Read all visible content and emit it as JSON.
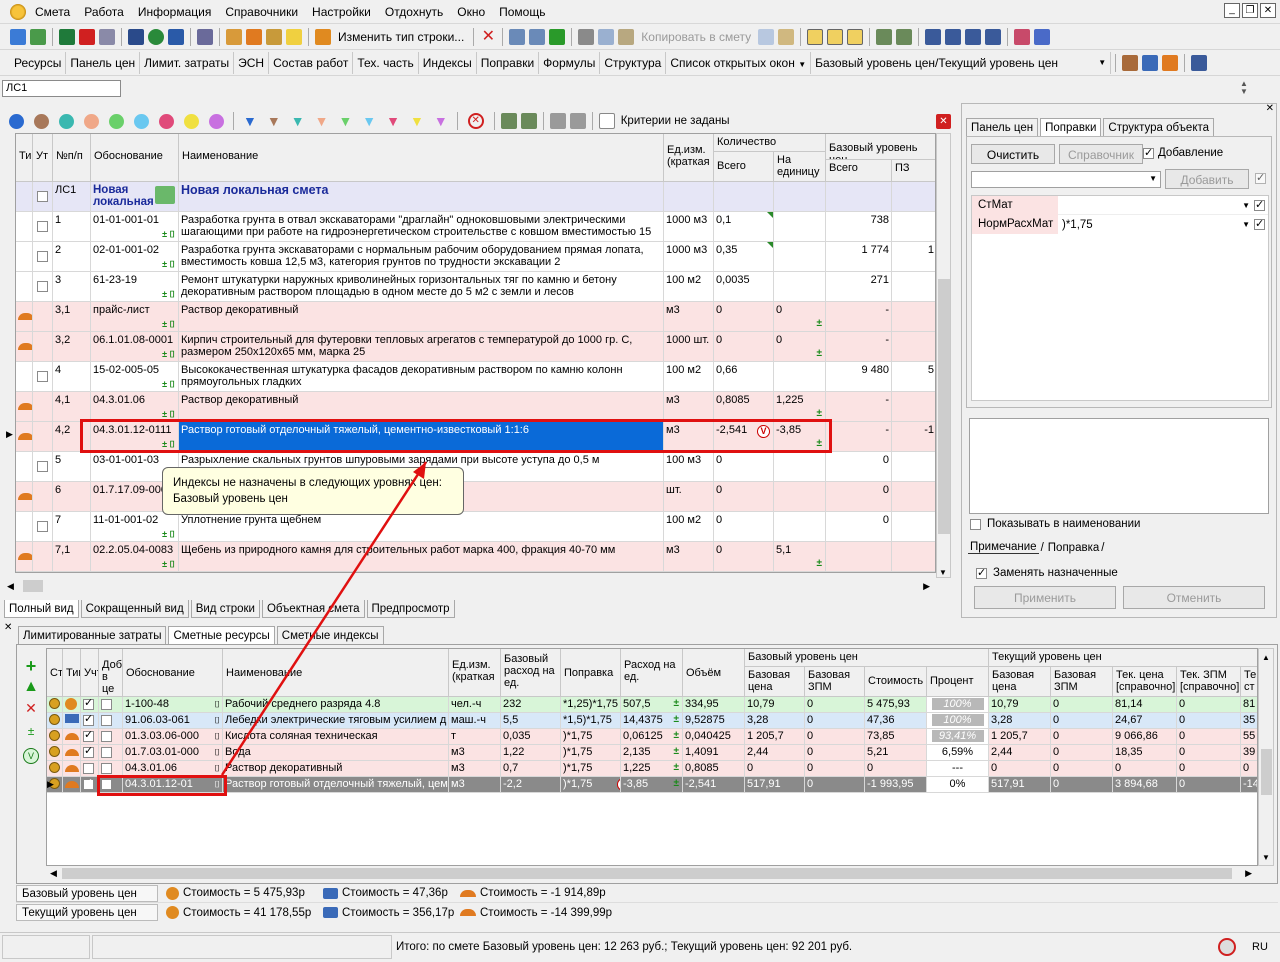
{
  "menu": [
    "Смета",
    "Работа",
    "Информация",
    "Справочники",
    "Настройки",
    "Отдохнуть",
    "Окно",
    "Помощь"
  ],
  "toolbar": {
    "change_row_type": "Изменить тип строки...",
    "copy_to_estimate": "Копировать в смету"
  },
  "tabs_top": [
    "Ресурсы",
    "Панель цен",
    "Лимит. затраты",
    "ЭСН",
    "Состав работ",
    "Тех. часть",
    "Индексы",
    "Поправки",
    "Формулы",
    "Структура",
    "Список открытых окон",
    "Базовый уровень цен/Текущий уровень цен"
  ],
  "path_field": "ЛС1",
  "filter_status": "Критерии не заданы",
  "grid_headers": {
    "ti": "Ти",
    "ut": "Ут",
    "num": "№п/п",
    "basis": "Обоснование",
    "name": "Наименование",
    "unit": "Ед.изм. (краткая",
    "qty": "Количество",
    "qty_total": "Всего",
    "qty_per": "На единицу",
    "base_level": "Базовый уровень цен",
    "base_total": "Всего",
    "pz": "ПЗ"
  },
  "grid_rows": [
    {
      "num": "ЛС1",
      "basis": "Новая локальная",
      "name": "Новая локальная смета",
      "unit": "",
      "total": "",
      "per": "",
      "sum": "",
      "pz": "",
      "style": "header"
    },
    {
      "num": "1",
      "basis": "01-01-001-01",
      "name": "Разработка грунта в отвал экскаваторами \"драглайн\" одноковшовыми электрическими шагающими при работе на гидроэнергетическом строительстве с ковшом вместимостью 15",
      "unit": "1000 м3",
      "total": "0,1",
      "per": "",
      "sum": "738",
      "pz": "",
      "style": "white"
    },
    {
      "num": "2",
      "basis": "02-01-001-02",
      "name": "Разработка грунта экскаваторами с нормальным рабочим оборудованием прямая лопата, вместимость ковша 12,5 м3, категория грунтов по трудности экскавации 2",
      "unit": "1000 м3",
      "total": "0,35",
      "per": "",
      "sum": "1 774",
      "pz": "1",
      "style": "white"
    },
    {
      "num": "3",
      "basis": "61-23-19",
      "name": "Ремонт штукатурки наружных криволинейных горизонтальных тяг по камню и бетону декоративным раствором площадью в одном месте до 5 м2 с земли и лесов",
      "unit": "100 м2",
      "total": "0,0035",
      "per": "",
      "sum": "271",
      "pz": "",
      "style": "white"
    },
    {
      "num": "3,1",
      "basis": "прайс-лист",
      "name": "Раствор декоративный",
      "unit": "м3",
      "total": "0",
      "per": "0",
      "sum": "-",
      "pz": "",
      "style": "pink"
    },
    {
      "num": "3,2",
      "basis": "06.1.01.08-0001",
      "name": "Кирпич строительный для футеровки тепловых агрегатов с температурой до 1000 гр. С, размером 250х120х65 мм, марка 25",
      "unit": "1000 шт.",
      "total": "0",
      "per": "0",
      "sum": "-",
      "pz": "",
      "style": "pink"
    },
    {
      "num": "4",
      "basis": "15-02-005-05",
      "name": "Высококачественная штукатурка фасадов декоративным раствором по камню колонн прямоугольных гладких",
      "unit": "100 м2",
      "total": "0,66",
      "per": "",
      "sum": "9 480",
      "pz": "5",
      "style": "white"
    },
    {
      "num": "4,1",
      "basis": "04.3.01.06",
      "name": "Раствор декоративный",
      "unit": "м3",
      "total": "0,8085",
      "per": "1,225",
      "sum": "-",
      "pz": "",
      "style": "pink"
    },
    {
      "num": "4,2",
      "basis": "04.3.01.12-0111",
      "name": "Раствор готовый отделочный тяжелый, цементно-известковый 1:1:6",
      "unit": "м3",
      "total": "-2,541",
      "per": "-3,85",
      "sum": "-",
      "pz": "-1",
      "style": "pink"
    },
    {
      "num": "5",
      "basis": "03-01-001-03",
      "name": "Разрыхление скальных грунтов шпуровыми зарядами при высоте уступа до 0,5 м",
      "unit": "100 м3",
      "total": "0",
      "per": "",
      "sum": "0",
      "pz": "",
      "style": "white"
    },
    {
      "num": "6",
      "basis": "01.7.17.09-000",
      "name": "",
      "unit": "шт.",
      "total": "0",
      "per": "",
      "sum": "0",
      "pz": "",
      "style": "pink"
    },
    {
      "num": "7",
      "basis": "11-01-001-02",
      "name": "Уплотнение грунта щебнем",
      "unit": "100 м2",
      "total": "0",
      "per": "",
      "sum": "0",
      "pz": "",
      "style": "white"
    },
    {
      "num": "7,1",
      "basis": "02.2.05.04-0083",
      "name": "Щебень из природного камня для строительных работ марка 400, фракция 40-70 мм",
      "unit": "м3",
      "total": "0",
      "per": "5,1",
      "sum": "",
      "pz": "",
      "style": "pink"
    }
  ],
  "tooltip": {
    "line1": "Индексы не назначены в следующих уровнях цен:",
    "line2": "Базовый уровень цен"
  },
  "view_tabs": [
    "Полный вид",
    "Сокращенный вид",
    "Вид строки",
    "Объектная смета",
    "Предпросмотр"
  ],
  "right_panel": {
    "tabs": [
      "Панель цен",
      "Поправки",
      "Структура объекта"
    ],
    "clear": "Очистить",
    "directory": "Справочник",
    "adding": "Добавление",
    "add": "Добавить",
    "items": [
      {
        "name": "СтМат",
        "value": ""
      },
      {
        "name": "НормРасхМат",
        "value": ")*1,75"
      }
    ],
    "show_in_name": "Показывать в наименовании",
    "note_tab": "Примечание",
    "correction_tab": "Поправка",
    "replace_assigned": "Заменять назначенные",
    "apply": "Применить",
    "cancel": "Отменить"
  },
  "bottom_tabs": [
    "Лимитированные затраты",
    "Сметные ресурсы",
    "Сметные индексы"
  ],
  "res_headers": {
    "st": "Ста",
    "tip": "Тип",
    "uch": "Учт",
    "dob": "Доб в це",
    "basis": "Обоснование",
    "name": "Наименование",
    "unit": "Ед.изм. (краткая",
    "base_rate": "Базовый расход на ед.",
    "corr": "Поправка",
    "rate": "Расход на ед.",
    "vol": "Объём",
    "base_group": "Базовый уровень цен",
    "base_price": "Базовая цена",
    "base_zpm": "Базовая ЗПМ",
    "cost": "Стоимость",
    "pct": "Процент",
    "cur_group": "Текущий уровень цен",
    "cur_price": "Базовая цена",
    "cur_zpm": "Базовая ЗПМ",
    "tek_price": "Тек. цена [справочно]",
    "tek_zpm": "Тек. ЗПМ [справочно]",
    "te": "Те ст"
  },
  "res_rows": [
    {
      "basis": "1-100-48",
      "name": "Рабочий среднего разряда 4.8",
      "unit": "чел.-ч",
      "brate": "232",
      "corr": "*1,25)*1,75",
      "rate": "507,5",
      "vol": "334,95",
      "bprice": "10,79",
      "bzpm": "0",
      "cost": "5 475,93",
      "pct": "100%",
      "cprice": "10,79",
      "czpm": "0",
      "tprice": "81,14",
      "tzpm": "0",
      "te": "81",
      "style": "green",
      "checked": true
    },
    {
      "basis": "91.06.03-061",
      "name": "Лебедки электрические тяговым усилием д",
      "unit": "маш.-ч",
      "brate": "5,5",
      "corr": "*1,5)*1,75",
      "rate": "14,4375",
      "vol": "9,52875",
      "bprice": "3,28",
      "bzpm": "0",
      "cost": "47,36",
      "pct": "100%",
      "cprice": "3,28",
      "czpm": "0",
      "tprice": "24,67",
      "tzpm": "0",
      "te": "35",
      "style": "blue",
      "checked": true
    },
    {
      "basis": "01.3.03.06-000",
      "name": "Кислота соляная техническая",
      "unit": "т",
      "brate": "0,035",
      "corr": ")*1,75",
      "rate": "0,06125",
      "vol": "0,040425",
      "bprice": "1 205,7",
      "bzpm": "0",
      "cost": "73,85",
      "pct": "93,41%",
      "cprice": "1 205,7",
      "czpm": "0",
      "tprice": "9 066,86",
      "tzpm": "0",
      "te": "55",
      "style": "pink",
      "checked": true
    },
    {
      "basis": "01.7.03.01-000",
      "name": "Вода",
      "unit": "м3",
      "brate": "1,22",
      "corr": ")*1,75",
      "rate": "2,135",
      "vol": "1,4091",
      "bprice": "2,44",
      "bzpm": "0",
      "cost": "5,21",
      "pct": "6,59%",
      "cprice": "2,44",
      "czpm": "0",
      "tprice": "18,35",
      "tzpm": "0",
      "te": "39",
      "style": "pink",
      "checked": true
    },
    {
      "basis": "04.3.01.06",
      "name": "Раствор декоративный",
      "unit": "м3",
      "brate": "0,7",
      "corr": ")*1,75",
      "rate": "1,225",
      "vol": "0,8085",
      "bprice": "0",
      "bzpm": "0",
      "cost": "0",
      "pct": "---",
      "cprice": "0",
      "czpm": "0",
      "tprice": "0",
      "tzpm": "0",
      "te": "0",
      "style": "pink",
      "checked": false
    },
    {
      "basis": "04.3.01.12-01",
      "name": "Раствор готовый отделочный тяжелый, цем",
      "unit": "м3",
      "brate": "-2,2",
      "corr": ")*1,75",
      "rate": "-3,85",
      "vol": "-2,541",
      "bprice": "517,91",
      "bzpm": "0",
      "cost": "-1 993,95",
      "pct": "0%",
      "cprice": "517,91",
      "czpm": "0",
      "tprice": "3 894,68",
      "tzpm": "0",
      "te": "-14",
      "style": "gray",
      "checked": true
    }
  ],
  "totals": {
    "base_label": "Базовый уровень цен",
    "cur_label": "Текущий уровень цен",
    "base": [
      "Стоимость = 5 475,93р",
      "Стоимость = 47,36р",
      "Стоимость = -1 914,89р"
    ],
    "cur": [
      "Стоимость = 41 178,55р",
      "Стоимость = 356,17р",
      "Стоимость = -14 399,99р"
    ]
  },
  "status": {
    "text": "Итого: по смете Базовый уровень цен: 12 263 руб.; Текущий уровень цен: 92 201 руб.",
    "lang": "RU"
  },
  "colors": {
    "highlight": "#e01010",
    "selection": "#0a6ad8",
    "pink_row": "#fbe3e3",
    "green_row": "#d8f5d8",
    "blue_row": "#d8e8f8"
  }
}
